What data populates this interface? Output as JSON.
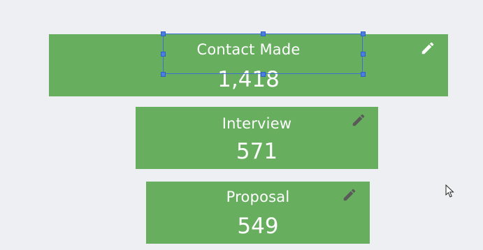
{
  "cards": [
    {
      "label": "Contact Made",
      "value": "1,418",
      "edit_icon": "pencil-icon",
      "edit_icon_color": "#ffffff"
    },
    {
      "label": "Interview",
      "value": "571",
      "edit_icon": "pencil-icon",
      "edit_icon_color": "#5a5a5a"
    },
    {
      "label": "Proposal",
      "value": "549",
      "edit_icon": "pencil-icon",
      "edit_icon_color": "#5a5a5a"
    }
  ],
  "colors": {
    "background": "#eeeff2",
    "card": "#67ae5f",
    "text": "#ffffff",
    "selection": "#3d6fd8"
  }
}
